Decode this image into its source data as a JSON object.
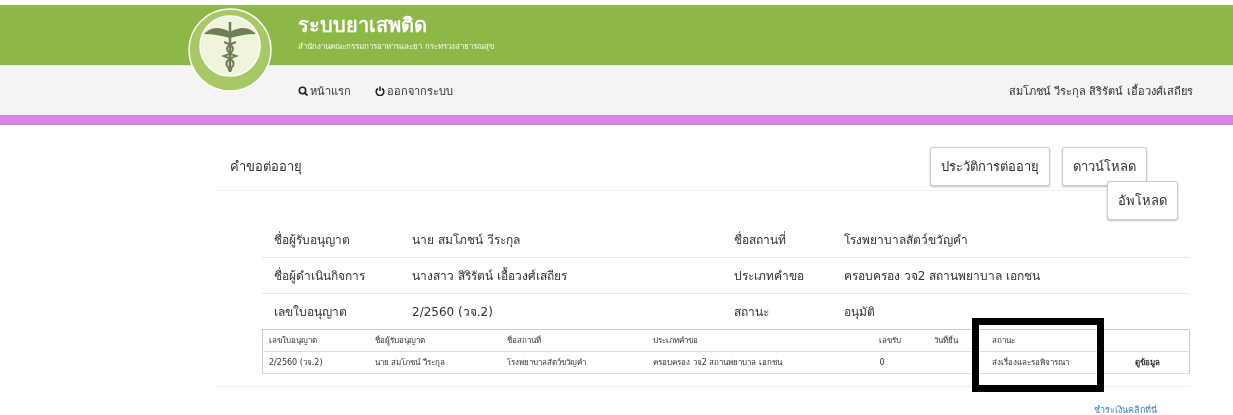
{
  "header": {
    "title": "ระบบยาเสพติด",
    "subtitle": "สำนักงานคณะกรรมการอาหารและยา กระทรวงสาธารณสุข"
  },
  "nav": {
    "links": [
      {
        "label": "หน้าแรก",
        "kind": "search"
      },
      {
        "label": "ออกจากระบบ",
        "kind": "power"
      }
    ],
    "user": "สมโภชน์ วีระกุล สิริรัตน์ เอื้อวงศ์เสถียร"
  },
  "panel": {
    "title": "คำขอต่ออายุ",
    "buttons": [
      "ประวัติการต่ออายุ",
      "ดาวน์โหลด"
    ],
    "upload_button": "อัพโหลด"
  },
  "details": [
    {
      "label": "ชื่อผู้รับอนุญาต",
      "value": "นาย สมโภชน์ วีระกุล",
      "label_2": "ชื่อสถานที่",
      "value_2": "โรงพยาบาลสัตว์ขวัญคำ"
    },
    {
      "label": "ชื่อผู้ดำเนินกิจการ",
      "value": "นางสาว สิริรัตน์ เอื้อวงศ์เสถียร",
      "label_2": "ประเภทคำขอ",
      "value_2": "ครอบครอง วจ2 สถานพยาบาล เอกชน"
    },
    {
      "label": "เลขใบอนุญาต",
      "value": "2/2560 (วจ.2)",
      "label_2": "สถานะ",
      "value_2": "อนุมัติ"
    }
  ],
  "table": {
    "columns": [
      "เลขใบอนุญาต",
      "ชื่อผู้รับอนุญาต",
      "ชื่อสถานที่",
      "ประเภทคำขอ",
      "เลขรับ",
      "วันที่ยื่น",
      "สถานะ"
    ],
    "rows": [
      {
        "cells": [
          "2/2560 (วจ.2)",
          "นาย สมโภชน์ วีระกุล",
          "โรงพยาบาลสัตว์ขวัญคำ",
          "ครอบครอง วจ2 สถานพยาบาล เอกชน",
          "0",
          "",
          "ส่งเรื่องและรอพิจารณา"
        ],
        "action": "ดูข้อมูล"
      }
    ]
  },
  "payment_link": "ชำระเงินคลิกที่นี่"
}
